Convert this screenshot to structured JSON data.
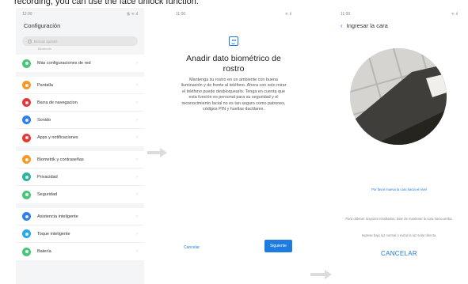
{
  "caption": "recording, you can use the face unlock function.",
  "screen1": {
    "time": "12:00",
    "status_right": "᯾ ᯤ.ıl",
    "title": "Configuración",
    "search_placeholder": "Buscar ajustes",
    "cut_text": "Bluetooth",
    "groups": [
      [
        {
          "label": "Más configuraciones de red",
          "color": "#4cc37a"
        }
      ],
      [
        {
          "label": "Pantalla",
          "color": "#f29a27"
        },
        {
          "label": "Barra de navegacion",
          "color": "#e0383e"
        },
        {
          "label": "Sonido",
          "color": "#2f7fe8"
        },
        {
          "label": "Apps y notificaciones",
          "color": "#e53935"
        }
      ],
      [
        {
          "label": "Biometrik y contraseñas",
          "color": "#f29a27"
        },
        {
          "label": "Privacidad",
          "color": "#2ab5a3"
        },
        {
          "label": "Seguridad",
          "color": "#4cc37a"
        }
      ],
      [
        {
          "label": "Asistencia inteligente",
          "color": "#2f7fe8"
        },
        {
          "label": "Toque inteligente",
          "color": "#29a8e8"
        },
        {
          "label": "Batería",
          "color": "#4cc37a"
        }
      ]
    ]
  },
  "screen2": {
    "time": "11:00",
    "status_right": "ᯤ.ıl",
    "heading": "Anadir dato biométrico de rostro",
    "body": "Mantenga su rostro en un ambiente con buena iluminación y de frente al teléfono. Ahora con solo mirar el teléfono puede desbloquearlo. Tenga en cuenta que esta función es personal para su seguridad y el reconocimiento facial no es tan seguro como patrones, códigos PIN y huellas dactilares.",
    "cancel_label": "Cancelar",
    "next_label": "Siguiente"
  },
  "screen3": {
    "time": "11:00",
    "status_right": "ᯤ.ıl",
    "back_icon": "‹",
    "title": "Ingresar la cara",
    "hint": "Por favor mueva la cara hacia el nivel",
    "tip1": "Para obtener mayores resultados, trate de mantener la cara hacia arriba.",
    "tip2": "Ingrese bajo luz normal o evitar la luz solar directa.",
    "cancel_label": "CANCELAR"
  },
  "colors": {
    "accent": "#1e7be0",
    "arrow": "#d9d9d9"
  }
}
